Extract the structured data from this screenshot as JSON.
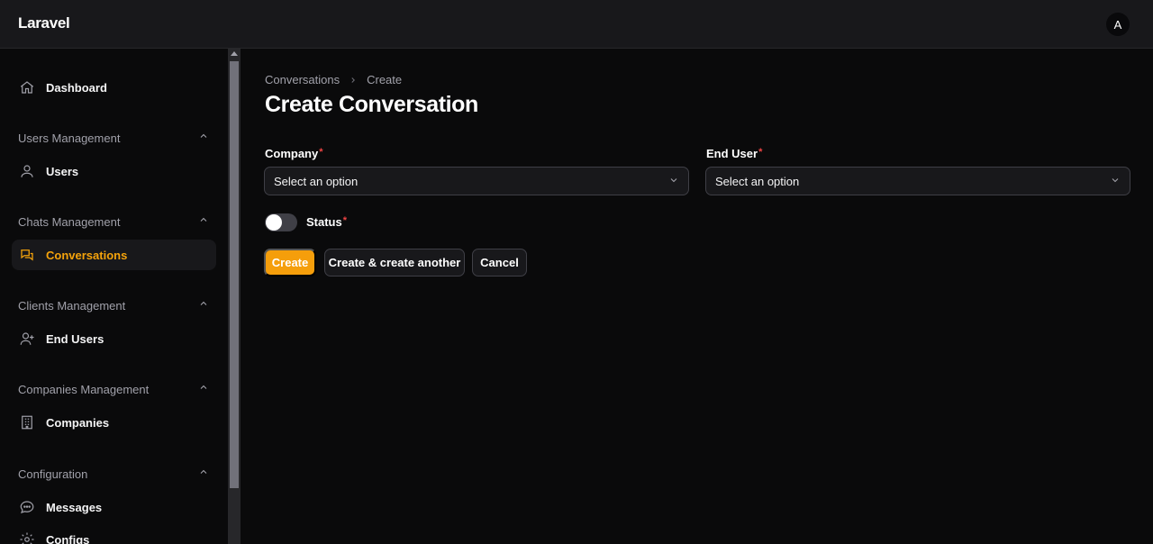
{
  "app": {
    "brand": "Laravel",
    "avatar_initial": "A"
  },
  "sidebar": {
    "dashboard": "Dashboard",
    "groups": [
      {
        "label": "Users Management",
        "items": [
          "Users"
        ]
      },
      {
        "label": "Chats Management",
        "items": [
          "Conversations"
        ]
      },
      {
        "label": "Clients Management",
        "items": [
          "End Users"
        ]
      },
      {
        "label": "Companies Management",
        "items": [
          "Companies"
        ]
      },
      {
        "label": "Configuration",
        "items": [
          "Messages",
          "Configs"
        ]
      }
    ],
    "active_item": "Conversations"
  },
  "breadcrumb": {
    "parent": "Conversations",
    "current": "Create"
  },
  "page": {
    "title": "Create Conversation"
  },
  "form": {
    "company": {
      "label": "Company",
      "required_mark": "*",
      "value": "Select an option"
    },
    "end_user": {
      "label": "End User",
      "required_mark": "*",
      "value": "Select an option"
    },
    "status": {
      "label": "Status",
      "required_mark": "*",
      "enabled": false
    }
  },
  "actions": {
    "create": "Create",
    "create_another": "Create & create another",
    "cancel": "Cancel"
  },
  "colors": {
    "accent": "#f59e0b",
    "background": "#0a0a0b",
    "surface": "#18181b",
    "required": "#ef4444"
  }
}
